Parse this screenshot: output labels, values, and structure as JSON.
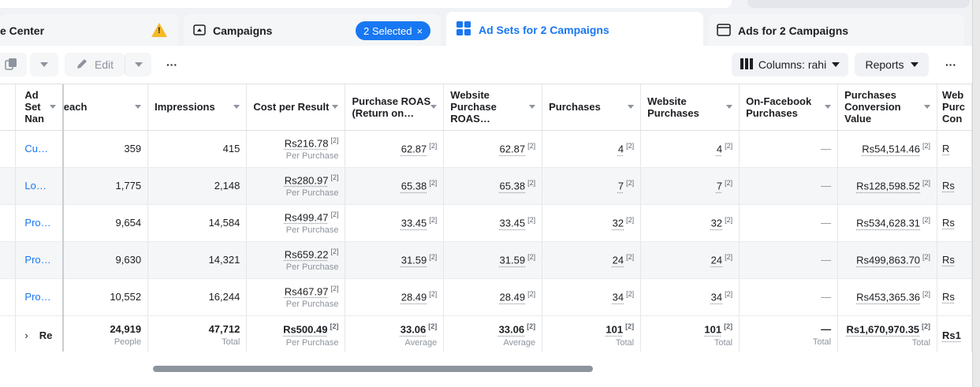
{
  "tabs": {
    "account": {
      "label": "e Center",
      "warning_symbol": "!"
    },
    "campaigns": {
      "label": "Campaigns",
      "selected_pill": "2 Selected",
      "close": "×"
    },
    "adsets": {
      "label": "Ad Sets for 2 Campaigns"
    },
    "ads": {
      "label": "Ads for 2 Campaigns"
    }
  },
  "toolbar": {
    "edit_label": "Edit",
    "more": "···",
    "columns_label": "Columns: rahi",
    "reports_label": "Reports",
    "more_right": "···"
  },
  "table": {
    "headers": {
      "name": "Ad Set Nan",
      "reach": "each",
      "impressions": "Impressions",
      "cpr": "Cost per Result",
      "roas": "Purchase ROAS (Return on…",
      "web_roas": "Website Purchase ROAS…",
      "purchases": "Purchases",
      "web_purchases": "Website Purchases",
      "fb_purchases": "On-Facebook Purchases",
      "conv_value": "Purchases Conversion Value",
      "web_cut": "Web Purc Con"
    },
    "rows": [
      {
        "name": "Cu…",
        "reach": "359",
        "impressions": "415",
        "cpr": "Rs216.78",
        "cpr_sub": "Per Purchase",
        "roas": "62.87",
        "web_roas": "62.87",
        "purchases": "4",
        "web_purchases": "4",
        "fb_purchases": "—",
        "conv_value": "Rs54,514.46",
        "web_cut": "R"
      },
      {
        "name": "Lo…",
        "reach": "1,775",
        "impressions": "2,148",
        "cpr": "Rs280.97",
        "cpr_sub": "Per Purchase",
        "roas": "65.38",
        "web_roas": "65.38",
        "purchases": "7",
        "web_purchases": "7",
        "fb_purchases": "—",
        "conv_value": "Rs128,598.52",
        "web_cut": "Rs"
      },
      {
        "name": "Pro…",
        "reach": "9,654",
        "impressions": "14,584",
        "cpr": "Rs499.47",
        "cpr_sub": "Per Purchase",
        "roas": "33.45",
        "web_roas": "33.45",
        "purchases": "32",
        "web_purchases": "32",
        "fb_purchases": "—",
        "conv_value": "Rs534,628.31",
        "web_cut": "Rs"
      },
      {
        "name": "Pro…",
        "reach": "9,630",
        "impressions": "14,321",
        "cpr": "Rs659.22",
        "cpr_sub": "Per Purchase",
        "roas": "31.59",
        "web_roas": "31.59",
        "purchases": "24",
        "web_purchases": "24",
        "fb_purchases": "—",
        "conv_value": "Rs499,863.70",
        "web_cut": "Rs"
      },
      {
        "name": "Pro…",
        "reach": "10,552",
        "impressions": "16,244",
        "cpr": "Rs467.97",
        "cpr_sub": "Per Purchase",
        "roas": "28.49",
        "web_roas": "28.49",
        "purchases": "34",
        "web_purchases": "34",
        "fb_purchases": "—",
        "conv_value": "Rs453,365.36",
        "web_cut": "Rs"
      }
    ],
    "superscript": "[2]",
    "total": {
      "name": "Re",
      "reach": "24,919",
      "reach_sub": "People",
      "impressions": "47,712",
      "impressions_sub": "Total",
      "cpr": "Rs500.49",
      "cpr_sub": "Per Purchase",
      "roas": "33.06",
      "roas_sub": "Average",
      "web_roas": "33.06",
      "web_roas_sub": "Average",
      "purchases": "101",
      "purchases_sub": "Total",
      "web_purchases": "101",
      "web_purchases_sub": "Total",
      "fb_purchases": "—",
      "fb_purchases_sub": "Total",
      "conv_value": "Rs1,670,970.35",
      "conv_value_sub": "Total",
      "web_cut": "Rs1"
    }
  },
  "colors": {
    "accent": "#1877f2",
    "warning": "#f7b928"
  }
}
